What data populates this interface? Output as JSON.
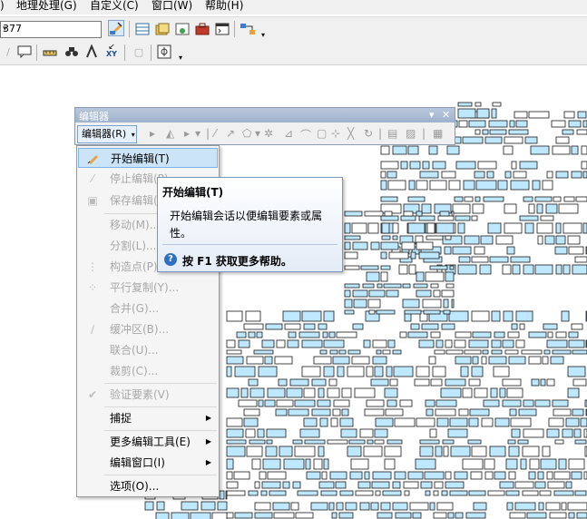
{
  "menubar": {
    "items": [
      "地理处理(G)",
      "自定义(C)",
      "窗口(W)",
      "帮助(H)"
    ],
    "prefix": ")"
  },
  "toolbar": {
    "scale_value": "377"
  },
  "editor_toolbar": {
    "title": "编辑器",
    "dropdown_label": "编辑器(R)"
  },
  "editor_menu": {
    "items": [
      {
        "label": "开始编辑(T)",
        "icon": "pencil-icon"
      },
      {
        "label": "停止编辑(P)",
        "icon": "stop-edit-icon"
      },
      {
        "label": "保存编辑(S)",
        "icon": "save-icon"
      },
      {
        "label": "移动(M)..."
      },
      {
        "label": "分割(L)..."
      },
      {
        "label": "构造点(P)...",
        "icon": "construct-points-icon"
      },
      {
        "label": "平行复制(Y)...",
        "icon": "copy-parallel-icon"
      },
      {
        "label": "合并(G)..."
      },
      {
        "label": "缓冲区(B)...",
        "icon": "buffer-icon"
      },
      {
        "label": "联合(U)..."
      },
      {
        "label": "裁剪(C)..."
      },
      {
        "label": "验证要素(V)",
        "icon": "validate-icon"
      },
      {
        "label": "捕捉"
      },
      {
        "label": "更多编辑工具(E)"
      },
      {
        "label": "编辑窗口(I)"
      },
      {
        "label": "选项(O)..."
      }
    ]
  },
  "tooltip": {
    "title": "开始编辑(T)",
    "body": "开始编辑会话以便编辑要素或属性。",
    "help": "按 F1 获取更多帮助。"
  },
  "colors": {
    "feature_fill": "#bee8ff",
    "feature_stroke": "#1a1a1a",
    "menu_highlight": "#cce4f7",
    "title_bar": "#a9bbd3"
  }
}
